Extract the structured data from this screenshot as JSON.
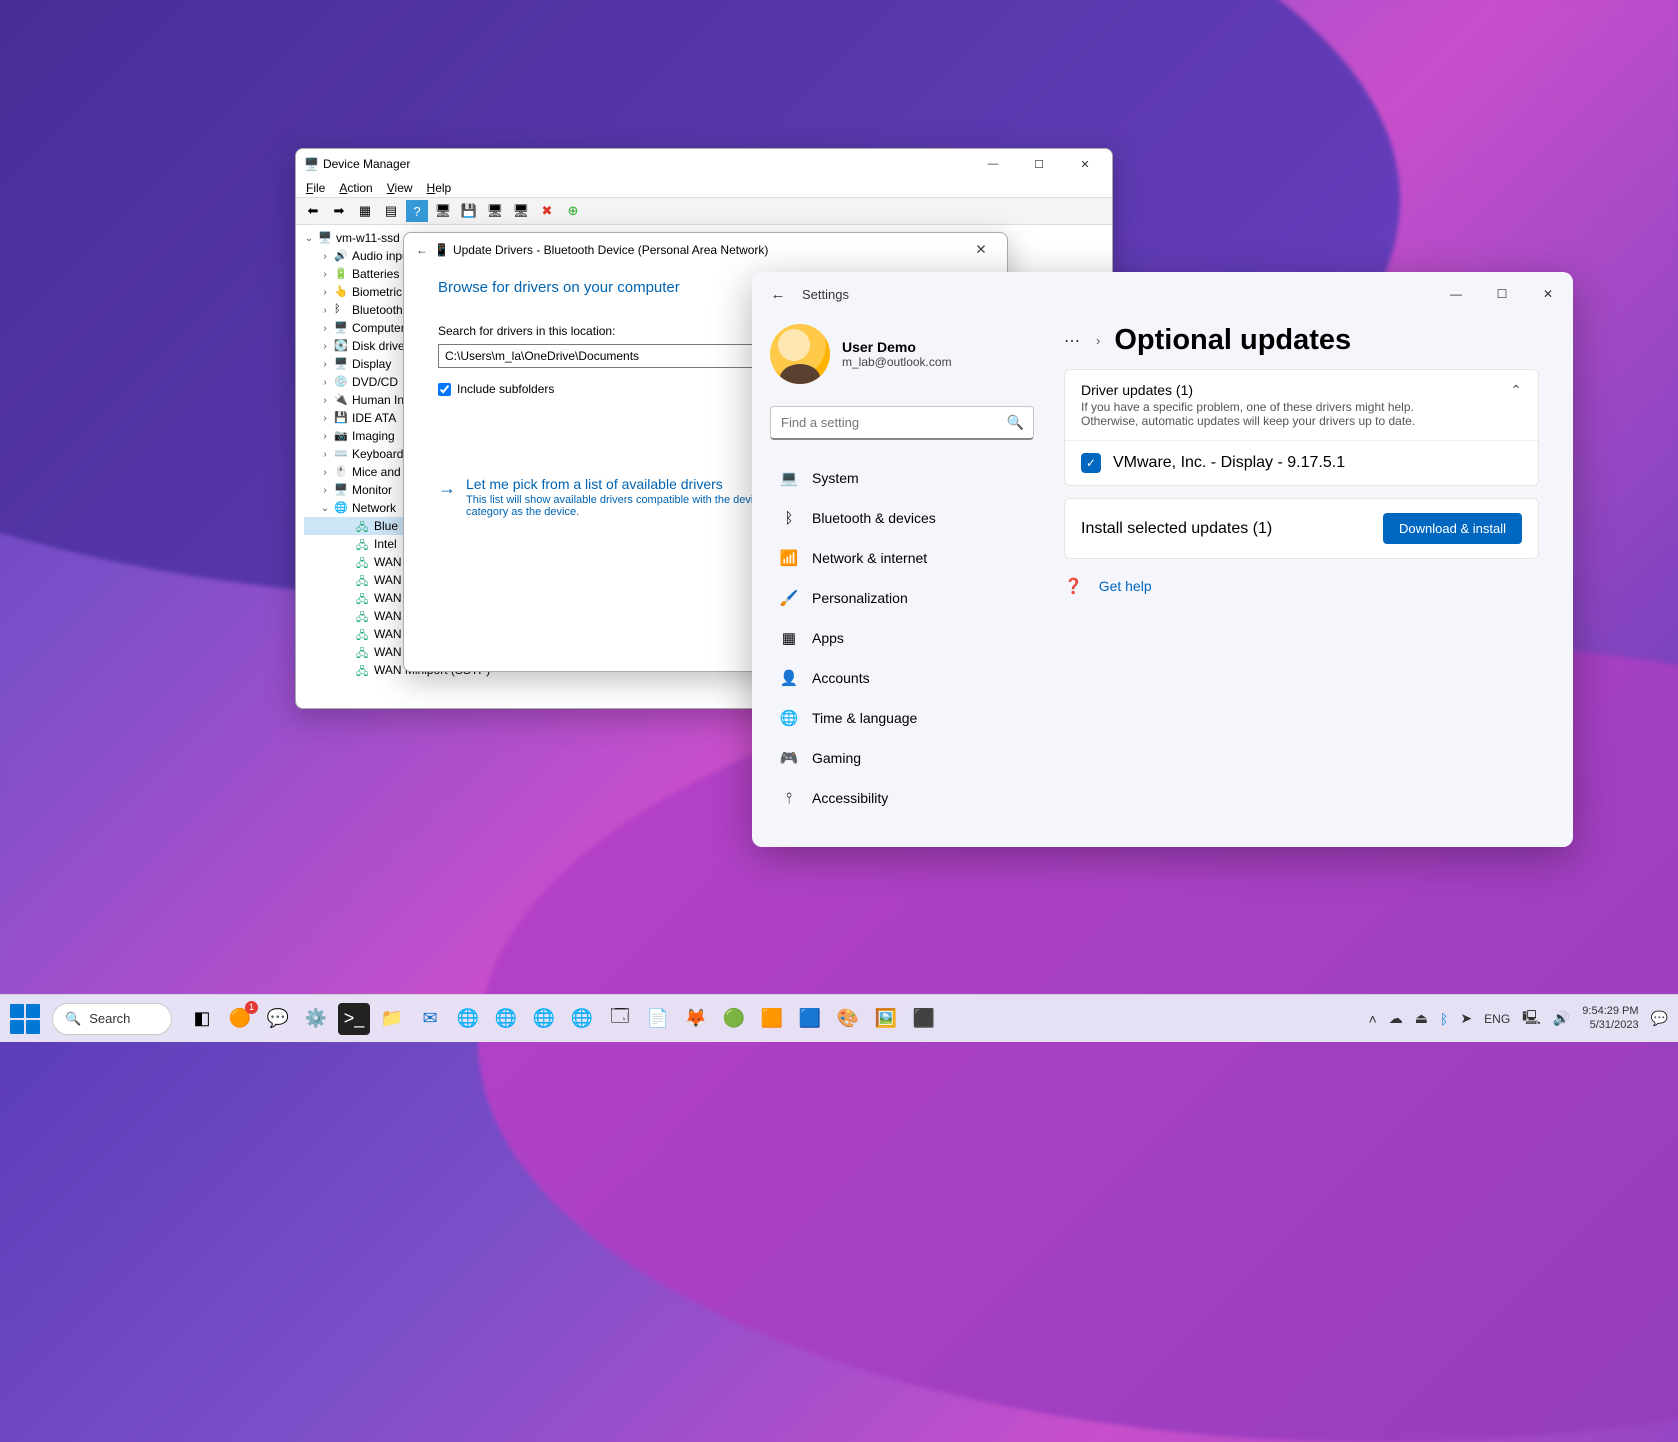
{
  "devmgr": {
    "title": "Device Manager",
    "menus": {
      "file": "File",
      "action": "Action",
      "view": "View",
      "help": "Help"
    },
    "root": "vm-w11-ssd",
    "nodes": [
      "Audio inputs",
      "Batteries",
      "Biometric",
      "Bluetooth",
      "Computer",
      "Disk drives",
      "Display",
      "DVD/CD",
      "Human Interface",
      "IDE ATA",
      "Imaging",
      "Keyboard",
      "Mice and",
      "Monitor",
      "Network"
    ],
    "network_children": [
      "Blue",
      "Intel",
      "WAN",
      "WAN",
      "WAN",
      "WAN",
      "WAN",
      "WAN",
      "WAN Miniport (SSTP)"
    ]
  },
  "upddlg": {
    "title": "Update Drivers - Bluetooth Device (Personal Area Network)",
    "heading": "Browse for drivers on your computer",
    "search_label": "Search for drivers in this location:",
    "path": "C:\\Users\\m_la\\OneDrive\\Documents",
    "include_subfolders": "Include subfolders",
    "pick_title": "Let me pick from a list of available drivers",
    "pick_desc": "This list will show available drivers compatible with the device and all drivers in the same category as the device."
  },
  "settings": {
    "app_label": "Settings",
    "user": {
      "name": "User Demo",
      "email": "m_lab@outlook.com"
    },
    "search_placeholder": "Find a setting",
    "nav": [
      {
        "icon": "💻",
        "label": "System"
      },
      {
        "icon": "ᛒ",
        "label": "Bluetooth & devices"
      },
      {
        "icon": "📶",
        "label": "Network & internet"
      },
      {
        "icon": "🖌️",
        "label": "Personalization"
      },
      {
        "icon": "▦",
        "label": "Apps"
      },
      {
        "icon": "👤",
        "label": "Accounts"
      },
      {
        "icon": "🌐",
        "label": "Time & language"
      },
      {
        "icon": "🎮",
        "label": "Gaming"
      },
      {
        "icon": "⫯",
        "label": "Accessibility"
      }
    ],
    "page_title": "Optional updates",
    "driver_card": {
      "title": "Driver updates (1)",
      "desc": "If you have a specific problem, one of these drivers might help. Otherwise, automatic updates will keep your drivers up to date.",
      "item": "VMware, Inc. - Display - 9.17.5.1"
    },
    "install_label": "Install selected updates (1)",
    "install_button": "Download & install",
    "help": "Get help"
  },
  "taskbar": {
    "search": "Search",
    "lang": "ENG",
    "time": "9:54:29 PM",
    "date": "5/31/2023"
  }
}
